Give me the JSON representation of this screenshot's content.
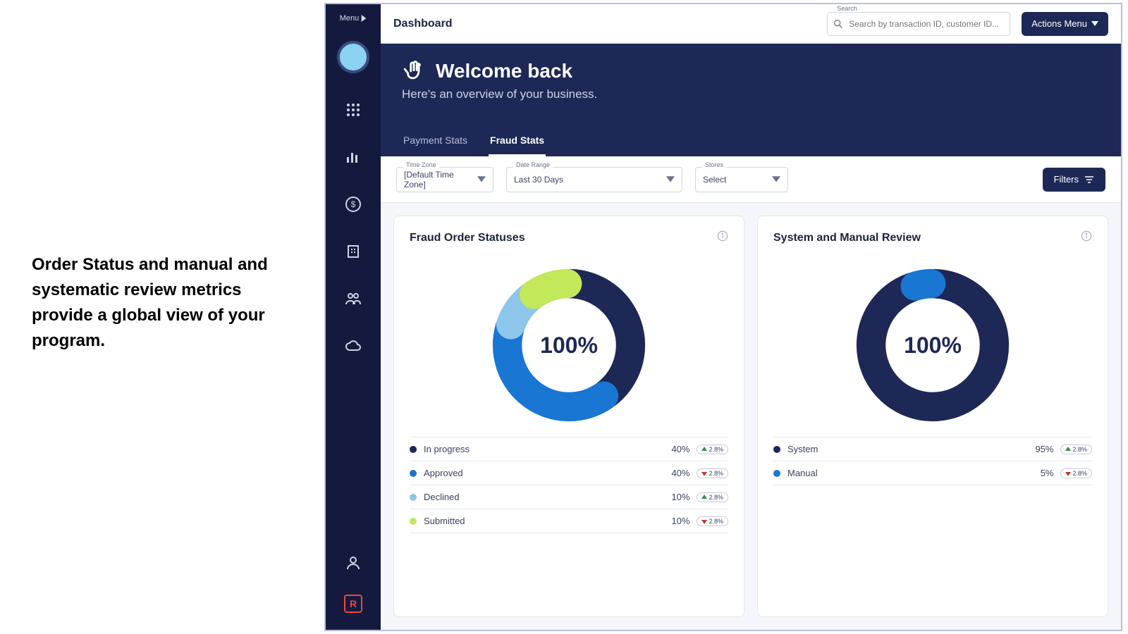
{
  "slide_caption": "Order Status and manual and systematic review metrics provide a global view of your program.",
  "sidebar": {
    "menu_label": "Menu",
    "logo_letter": "R"
  },
  "topbar": {
    "title": "Dashboard",
    "search_label": "Search",
    "search_placeholder": "Search by transaction ID, customer ID...",
    "actions_label": "Actions Menu"
  },
  "hero": {
    "title": "Welcome back",
    "subtitle": "Here's an overview of your business.",
    "tabs": [
      {
        "label": "Payment Stats",
        "active": false
      },
      {
        "label": "Fraud Stats",
        "active": true
      }
    ]
  },
  "filters": {
    "time_zone": {
      "label": "Time Zone",
      "value": "[Default Time Zone]"
    },
    "date_range": {
      "label": "Date Range",
      "value": "Last 30 Days"
    },
    "stores": {
      "label": "Stores",
      "value": "Select"
    },
    "button": "Filters"
  },
  "cards": {
    "fraud": {
      "title": "Fraud Order Statuses",
      "center": "100%"
    },
    "review": {
      "title": "System and Manual Review",
      "center": "100%"
    }
  },
  "chart_data": [
    {
      "type": "pie",
      "title": "Fraud Order Statuses",
      "center_label": "100%",
      "series": [
        {
          "name": "In progress",
          "value": 40,
          "color": "#1d2856",
          "delta": "2.8%",
          "dir": "up"
        },
        {
          "name": "Approved",
          "value": 40,
          "color": "#1976d2",
          "delta": "2.8%",
          "dir": "down"
        },
        {
          "name": "Declined",
          "value": 10,
          "color": "#8cc6ea",
          "delta": "2.8%",
          "dir": "up"
        },
        {
          "name": "Submitted",
          "value": 10,
          "color": "#c3e85a",
          "delta": "2.8%",
          "dir": "down"
        }
      ]
    },
    {
      "type": "pie",
      "title": "System and Manual Review",
      "center_label": "100%",
      "series": [
        {
          "name": "System",
          "value": 95,
          "color": "#1d2856",
          "delta": "2.8%",
          "dir": "up"
        },
        {
          "name": "Manual",
          "value": 5,
          "color": "#1976d2",
          "delta": "2.8%",
          "dir": "down"
        }
      ]
    }
  ]
}
